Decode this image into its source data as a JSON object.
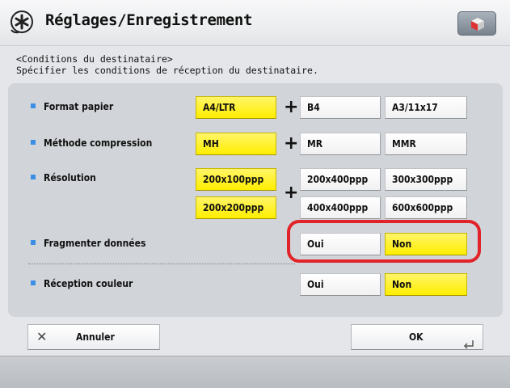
{
  "header": {
    "title": "Réglages/Enregistrement",
    "icon": "settings-star-icon",
    "right_icon": "cube-icon"
  },
  "instructions": {
    "line1": "<Conditions du destinataire>",
    "line2": "Spécifier les conditions de réception du destinataire."
  },
  "rows": {
    "format": {
      "label": "Format papier",
      "options": [
        "A4/LTR",
        "B4",
        "A3/11x17"
      ],
      "selected": [
        "A4/LTR"
      ]
    },
    "compression": {
      "label": "Méthode compression",
      "options": [
        "MH",
        "MR",
        "MMR"
      ],
      "selected": [
        "MH"
      ]
    },
    "resolution": {
      "label": "Résolution",
      "options": [
        "200x100ppp",
        "200x200ppp",
        "200x400ppp",
        "300x300ppp",
        "400x400ppp",
        "600x600ppp"
      ],
      "selected": [
        "200x100ppp",
        "200x200ppp"
      ]
    },
    "fragment": {
      "label": "Fragmenter données",
      "options": [
        "Oui",
        "Non"
      ],
      "selected": [
        "Non"
      ]
    },
    "color": {
      "label": "Réception couleur",
      "options": [
        "Oui",
        "Non"
      ],
      "selected": [
        "Non"
      ]
    }
  },
  "plus_symbol": "+",
  "footer": {
    "cancel_label": "Annuler",
    "cancel_icon": "close-icon",
    "ok_label": "OK",
    "ok_icon": "return-arrow-icon"
  },
  "colors": {
    "selected": "#ffee00",
    "highlight": "#e0242a",
    "bullet": "#3a8ee6"
  }
}
